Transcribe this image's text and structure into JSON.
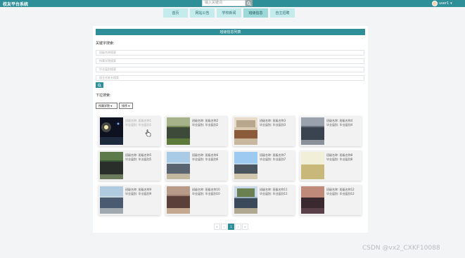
{
  "app": {
    "title": "校友平台系统"
  },
  "header": {
    "search_placeholder": "输入关键词",
    "search_icon": "search-icon",
    "user_name": "user1",
    "user_menu_caret": "▾"
  },
  "nav": {
    "tabs": [
      {
        "label": "首页",
        "active": false
      },
      {
        "label": "网站公告",
        "active": false
      },
      {
        "label": "学校新闻",
        "active": false
      },
      {
        "label": "班级信息",
        "active": true
      },
      {
        "label": "自主招聘",
        "active": false
      }
    ]
  },
  "panel": {
    "title": "班级信息列表",
    "keyword_label": "关键字搜索:",
    "fields": [
      {
        "placeholder": "班级名称搜索"
      },
      {
        "placeholder": "所属学院搜索"
      },
      {
        "placeholder": "毕业届别搜索"
      },
      {
        "placeholder": "班主任姓名搜索"
      }
    ],
    "search_button_icon": "search-icon",
    "dropdown_label": "下拉搜索:",
    "dropdowns": [
      {
        "label": "所属学院 ▾"
      },
      {
        "label": "排序 ▾"
      }
    ]
  },
  "cards": [
    {
      "line1": "班级名称: 班级名称1",
      "line2": "毕业届别: 毕业届别1",
      "muted": true,
      "photo": "night-stage"
    },
    {
      "line1": "班级名称: 班级名称2",
      "line2": "毕业届别: 毕业届别2",
      "muted": false,
      "photo": "group-grass"
    },
    {
      "line1": "班级名称: 班级名称3",
      "line2": "毕业届别: 毕业届别3",
      "muted": false,
      "photo": "group-building"
    },
    {
      "line1": "班级名称: 班级名称4",
      "line2": "毕业届别: 毕业届别4",
      "muted": false,
      "photo": "group-stairs"
    },
    {
      "line1": "班级名称: 班级名称5",
      "line2": "毕业届别: 毕业届别5",
      "muted": false,
      "photo": "group-trees"
    },
    {
      "line1": "班级名称: 班级名称6",
      "line2": "毕业届别: 毕业届别6",
      "muted": false,
      "photo": "group-sky"
    },
    {
      "line1": "班级名称: 班级名称7",
      "line2": "毕业届别: 毕业届别7",
      "muted": false,
      "photo": "group-campus"
    },
    {
      "line1": "班级名称: 班级名称8",
      "line2": "毕业届别: 毕业届别8",
      "muted": false,
      "photo": "bright-field"
    },
    {
      "line1": "班级名称: 班级名称9",
      "line2": "毕业届别: 毕业届别9",
      "muted": false,
      "photo": "group-street"
    },
    {
      "line1": "班级名称: 班级名称10",
      "line2": "毕业届别: 毕业届别10",
      "muted": false,
      "photo": "group-red"
    },
    {
      "line1": "班级名称: 班级名称11",
      "line2": "毕业届别: 毕业届别11",
      "muted": false,
      "photo": "group-gate"
    },
    {
      "line1": "班级名称: 班级名称12",
      "line2": "毕业届别: 毕业届别12",
      "muted": false,
      "photo": "sunset"
    }
  ],
  "pagination": {
    "items": [
      "«",
      "‹",
      "1",
      "›",
      "»"
    ],
    "current": "1"
  },
  "watermark": "CSDN @vx2_CXKF10088",
  "colors": {
    "accent": "#2f8f98",
    "nav_tab": "#c5ecec",
    "nav_tab_active": "#9cd9d9",
    "background": "#f3f4f5"
  }
}
